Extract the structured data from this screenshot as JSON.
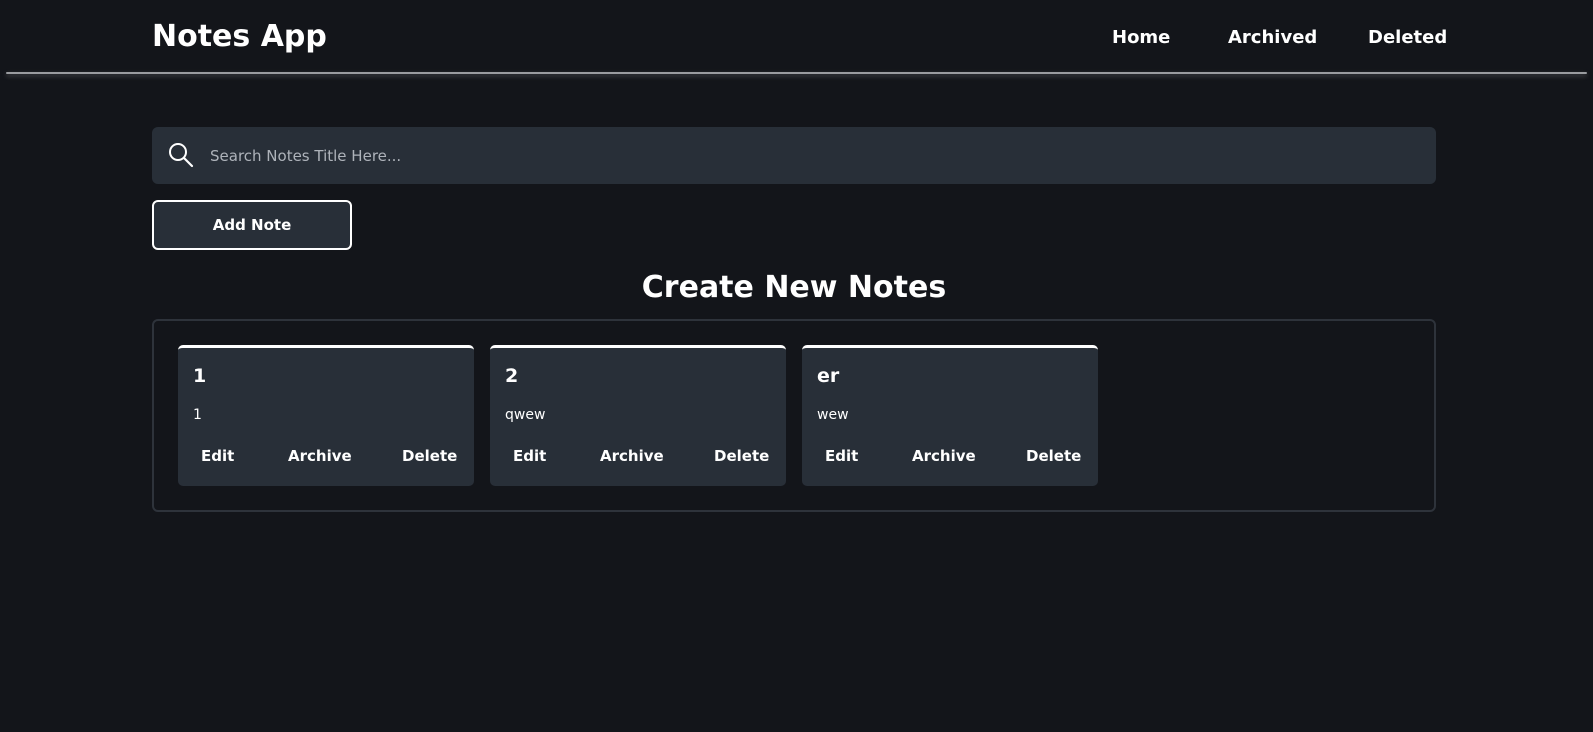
{
  "header": {
    "brand": "Notes App",
    "nav": {
      "home": "Home",
      "archived": "Archived",
      "deleted": "Deleted"
    }
  },
  "search": {
    "placeholder": "Search Notes Title Here...",
    "value": "",
    "icon": "search-icon"
  },
  "add_button_label": "Add Note",
  "section_title": "Create New Notes",
  "notes": [
    {
      "title": "1",
      "body": "1",
      "actions": {
        "edit": "Edit",
        "archive": "Archive",
        "delete": "Delete"
      }
    },
    {
      "title": "2",
      "body": "qwew",
      "actions": {
        "edit": "Edit",
        "archive": "Archive",
        "delete": "Delete"
      }
    },
    {
      "title": "er",
      "body": "wew",
      "actions": {
        "edit": "Edit",
        "archive": "Archive",
        "delete": "Delete"
      }
    }
  ],
  "colors": {
    "background": "#13151a",
    "surface": "#282f38",
    "text": "#ffffff",
    "accent_border": "#ffffff"
  }
}
